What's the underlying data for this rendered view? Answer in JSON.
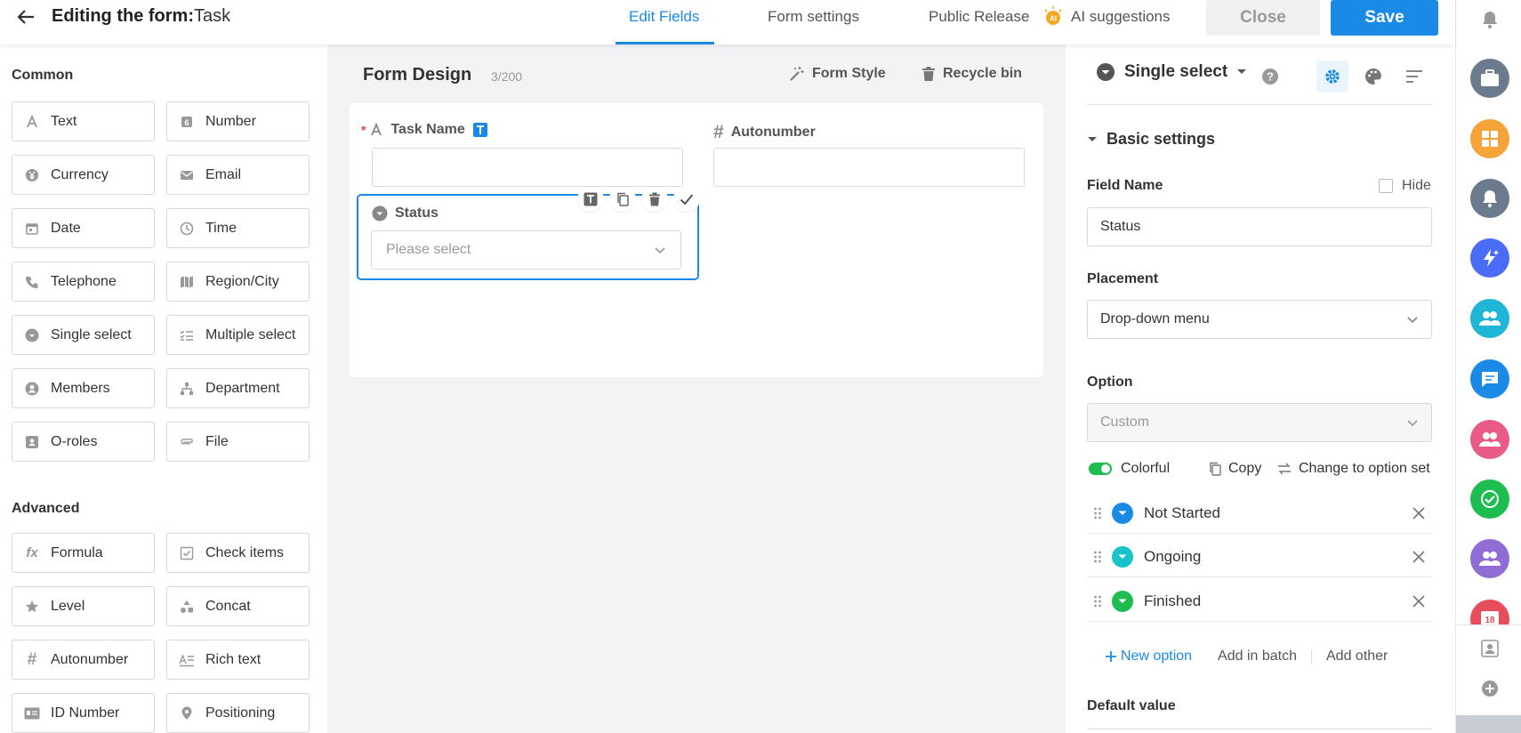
{
  "header": {
    "title_prefix": "Editing the form:",
    "title_name": "Task",
    "tabs": [
      {
        "label": "Edit Fields",
        "active": true
      },
      {
        "label": "Form settings",
        "active": false
      },
      {
        "label": "Public Release",
        "active": false
      }
    ],
    "ai_suggestions": "AI suggestions",
    "close_label": "Close",
    "save_label": "Save"
  },
  "left": {
    "common_title": "Common",
    "common_fields": [
      {
        "label": "Text",
        "icon": "text-icon"
      },
      {
        "label": "Number",
        "icon": "number-icon"
      },
      {
        "label": "Currency",
        "icon": "currency-icon"
      },
      {
        "label": "Email",
        "icon": "email-icon"
      },
      {
        "label": "Date",
        "icon": "date-icon"
      },
      {
        "label": "Time",
        "icon": "time-icon"
      },
      {
        "label": "Telephone",
        "icon": "phone-icon"
      },
      {
        "label": "Region/City",
        "icon": "map-icon"
      },
      {
        "label": "Single select",
        "icon": "single-select-icon"
      },
      {
        "label": "Multiple select",
        "icon": "multi-select-icon"
      },
      {
        "label": "Members",
        "icon": "member-icon"
      },
      {
        "label": "Department",
        "icon": "department-icon"
      },
      {
        "label": "O-roles",
        "icon": "role-icon"
      },
      {
        "label": "File",
        "icon": "attachment-icon"
      }
    ],
    "advanced_title": "Advanced",
    "advanced_fields": [
      {
        "label": "Formula",
        "icon": "formula-icon"
      },
      {
        "label": "Check items",
        "icon": "check-items-icon"
      },
      {
        "label": "Level",
        "icon": "star-icon"
      },
      {
        "label": "Concat",
        "icon": "concat-icon"
      },
      {
        "label": "Autonumber",
        "icon": "hash-icon"
      },
      {
        "label": "Rich text",
        "icon": "rich-text-icon"
      },
      {
        "label": "ID Number",
        "icon": "id-card-icon"
      },
      {
        "label": "Positioning",
        "icon": "location-icon"
      }
    ]
  },
  "design": {
    "title": "Form Design",
    "count": "3/200",
    "form_style": "Form Style",
    "recycle_bin": "Recycle bin",
    "fields": {
      "task_name": "Task Name",
      "autonumber": "Autonumber",
      "status": "Status",
      "status_placeholder": "Please select"
    }
  },
  "settings": {
    "field_type": "Single select",
    "basic_settings": "Basic settings",
    "field_name_label": "Field Name",
    "hide_label": "Hide",
    "field_name_value": "Status",
    "placement_label": "Placement",
    "placement_value": "Drop-down menu",
    "option_label": "Option",
    "option_source": "Custom",
    "colorful_label": "Colorful",
    "copy_label": "Copy",
    "change_option_set": "Change to option set",
    "options": [
      {
        "label": "Not Started",
        "color": "#1a8ae6"
      },
      {
        "label": "Ongoing",
        "color": "#17c3c9"
      },
      {
        "label": "Finished",
        "color": "#1ebd4f"
      }
    ],
    "new_option": "New option",
    "add_in_batch": "Add in batch",
    "add_other": "Add other",
    "default_value_label": "Default value"
  },
  "rail": {
    "calendar_day": "18"
  }
}
